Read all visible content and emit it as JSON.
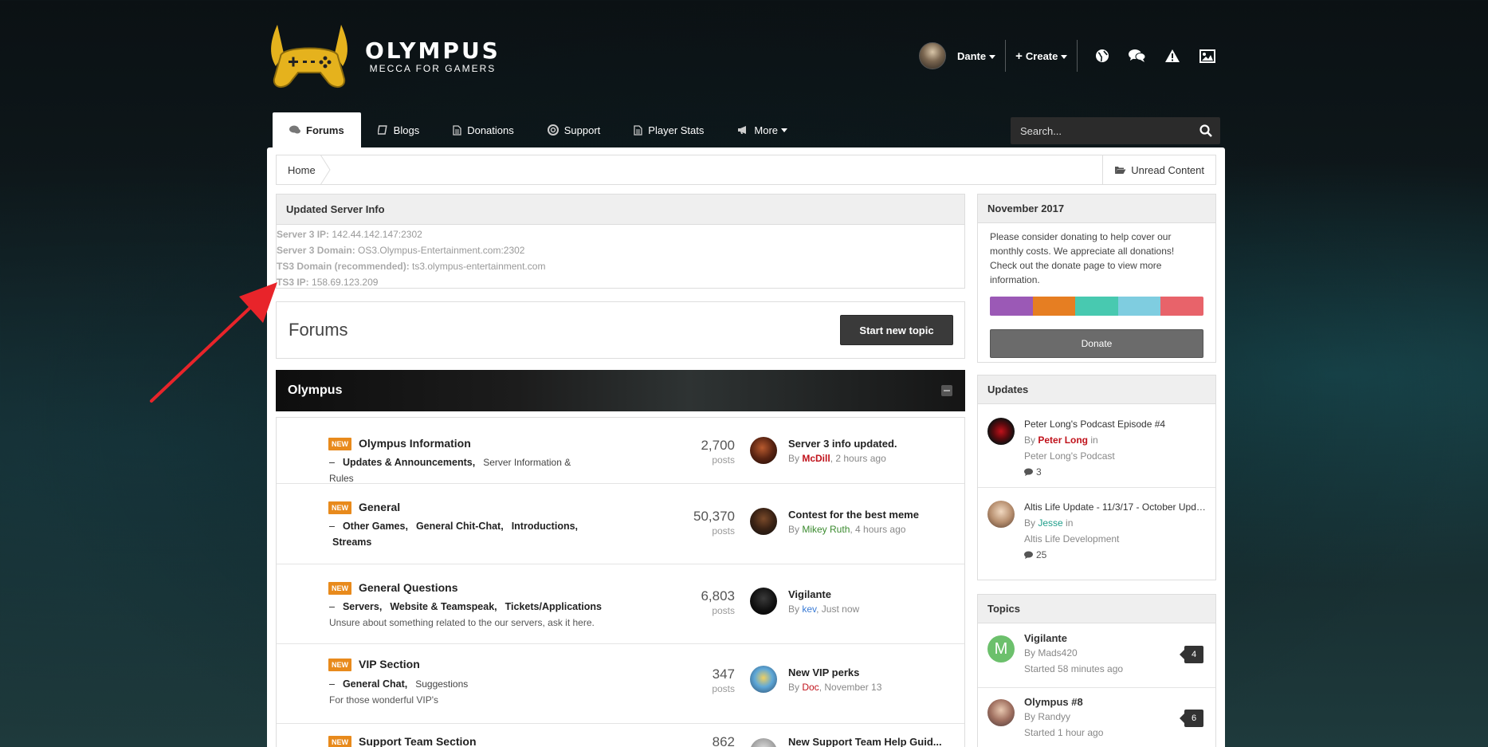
{
  "brand": {
    "title": "OLYMPUS",
    "subtitle": "MECCA FOR GAMERS"
  },
  "user_bar": {
    "user_name": "Dante",
    "create_label": "Create",
    "icons": [
      "globe-icon",
      "comments-icon",
      "warning-icon",
      "image-icon"
    ]
  },
  "nav": {
    "items": [
      {
        "label": "Forums",
        "icon": "comments-icon",
        "active": true
      },
      {
        "label": "Blogs",
        "icon": "book-icon"
      },
      {
        "label": "Donations",
        "icon": "document-icon"
      },
      {
        "label": "Support",
        "icon": "lifebuoy-icon"
      },
      {
        "label": "Player Stats",
        "icon": "document-icon"
      },
      {
        "label": "More",
        "icon": "megaphone-icon"
      }
    ]
  },
  "search": {
    "placeholder": "Search..."
  },
  "breadcrumb": {
    "home": "Home",
    "unread": "Unread Content"
  },
  "server_info": {
    "title": "Updated Server Info",
    "lines": [
      {
        "label": "Server 3 IP:",
        "value": " 142.44.142.147:2302"
      },
      {
        "label": "Server 3 Domain:",
        "value": " OS3.Olympus-Entertainment.com:2302"
      },
      {
        "label": "TS3 Domain (recommended):",
        "value": " ts3.olympus-entertainment.com"
      },
      {
        "label": "TS3 IP:",
        "value": " 158.69.123.209"
      }
    ]
  },
  "forums_header": {
    "title": "Forums",
    "button": "Start new topic"
  },
  "category": {
    "title": "Olympus"
  },
  "forums": [
    {
      "badge": "NEW",
      "title": "Olympus Information",
      "subforums": [
        {
          "name": "Updates & Announcements,",
          "strong": true
        },
        {
          "name": "Server Information & Rules",
          "strong": false
        }
      ],
      "subforums_line2": "",
      "description": "",
      "count": "2,700",
      "count_label": "posts",
      "last_title": "Server 3 info updated.",
      "last_by": "By ",
      "last_user": "McDill",
      "last_user_color": "#c0121b",
      "last_time": ", 2 hours ago"
    },
    {
      "badge": "NEW",
      "title": "General",
      "subforums": [
        {
          "name": "Other Games,",
          "strong": true
        },
        {
          "name": "General Chit-Chat,",
          "strong": true
        },
        {
          "name": "Introductions,",
          "strong": true
        }
      ],
      "subforums_line2": "Streams",
      "description": "",
      "count": "50,370",
      "count_label": "posts",
      "last_title": "Contest for the best meme",
      "last_by": "By ",
      "last_user": "Mikey Ruth",
      "last_user_color": "#3a8a2e",
      "last_time": ", 4 hours ago"
    },
    {
      "badge": "NEW",
      "title": "General Questions",
      "subforums": [
        {
          "name": "Servers,",
          "strong": true
        },
        {
          "name": "Website & Teamspeak,",
          "strong": true
        },
        {
          "name": "Tickets/Applications",
          "strong": true
        }
      ],
      "subforums_line2": "",
      "description": "Unsure about something related to the our servers, ask it here.",
      "count": "6,803",
      "count_label": "posts",
      "last_title": "Vigilante",
      "last_by": "By ",
      "last_user": "kev",
      "last_user_color": "#3a7bd5",
      "last_time": ", Just now"
    },
    {
      "badge": "NEW",
      "title": "VIP Section",
      "subforums": [
        {
          "name": "General Chat,",
          "strong": true
        },
        {
          "name": "Suggestions",
          "strong": false
        }
      ],
      "subforums_line2": "",
      "description": "For those wonderful VIP's",
      "count": "347",
      "count_label": "posts",
      "last_title": "New VIP perks",
      "last_by": "By ",
      "last_user": "Doc",
      "last_user_color": "#c0121b",
      "last_time": ", November 13"
    },
    {
      "badge": "NEW",
      "title": "Support Team Section",
      "subforums": [],
      "subforums_line2": "",
      "description": "",
      "count": "862",
      "count_label": "posts",
      "last_title": "New Support Team Help Guid...",
      "last_by": "",
      "last_user": "",
      "last_user_color": "#888888",
      "last_time": ""
    }
  ],
  "donation": {
    "title": "November 2017",
    "text": "Please consider donating to help cover our monthly costs. We appreciate all donations! Check out the donate page to view more information.",
    "bar_colors": [
      "#9b59b6",
      "#e67e22",
      "#48c9b0",
      "#7fcde0",
      "#e8636a"
    ],
    "button": "Donate"
  },
  "updates": {
    "title": "Updates",
    "items": [
      {
        "title": "Peter Long's Podcast Episode #4",
        "by": "By ",
        "user": "Peter Long",
        "user_color": "#c0121b",
        "in": " in",
        "blog": "Peter Long's Podcast",
        "comments": "3"
      },
      {
        "title": "Altis Life Update - 11/3/17 - October Upda...",
        "by": "By ",
        "user": "Jesse",
        "user_color": "#1e9e8a",
        "in": " in",
        "blog": "Altis Life Development",
        "comments": "25"
      }
    ]
  },
  "topics": {
    "title": "Topics",
    "items": [
      {
        "letter": "M",
        "title": "Vigilante",
        "by": "By Mads420",
        "started": "Started 58 minutes ago",
        "count": "4"
      },
      {
        "letter": "",
        "title": "Olympus #8",
        "by": "By Randyy",
        "started": "Started 1 hour ago",
        "count": "6"
      }
    ]
  },
  "colors": {
    "accent": "#e88a1c",
    "arrow": "#e8242a",
    "logo_gold": "#e5b21d"
  }
}
